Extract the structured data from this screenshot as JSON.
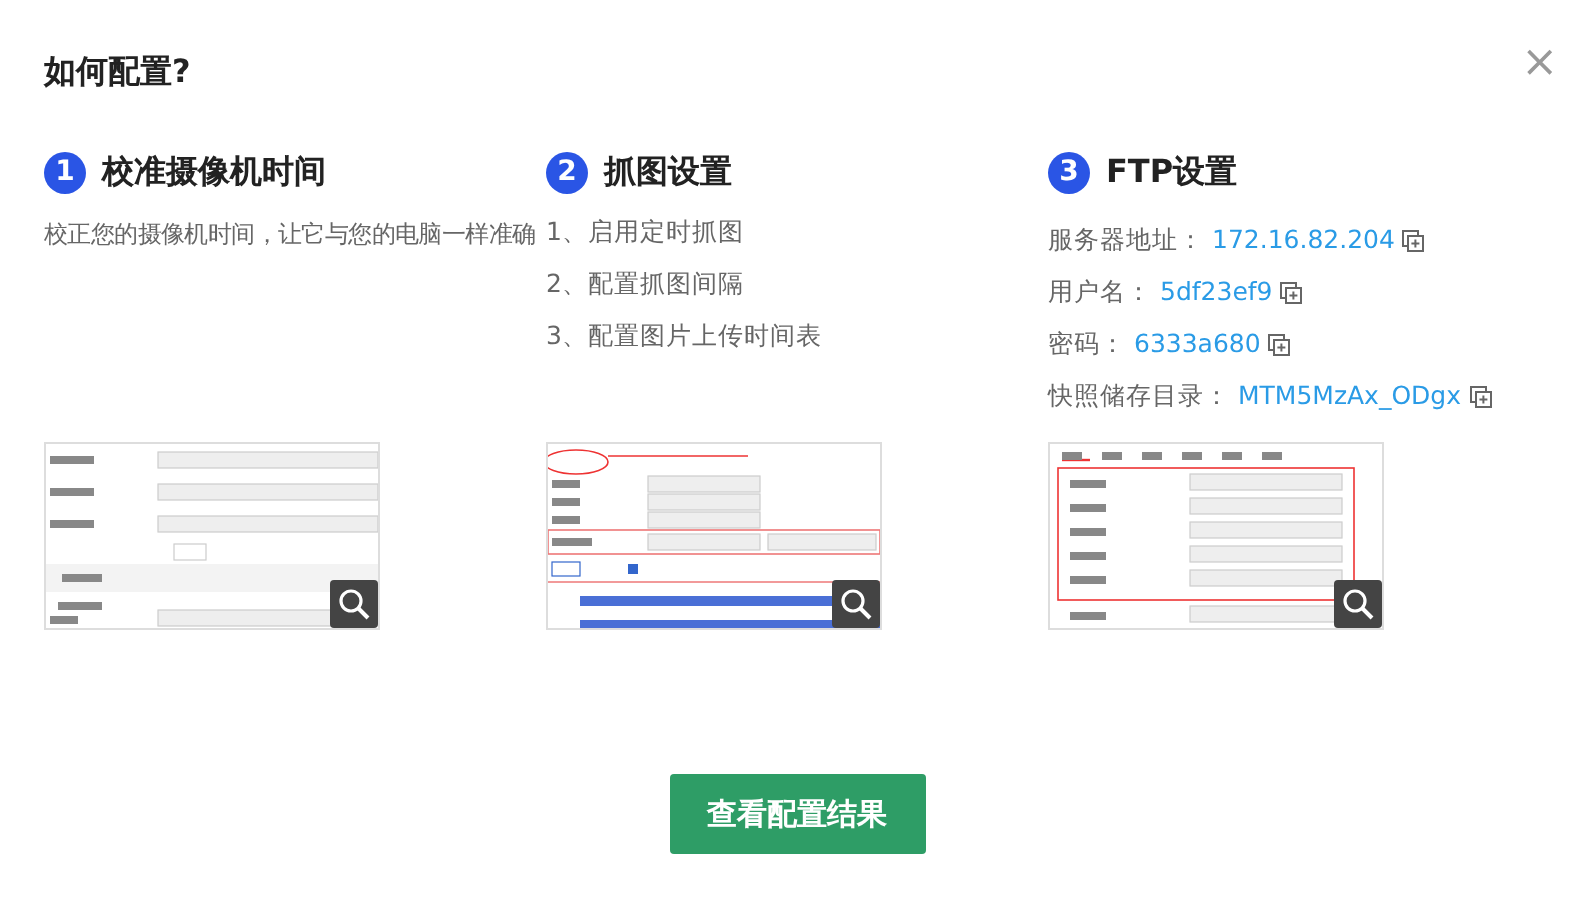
{
  "dialog": {
    "title": "如何配置?",
    "close": "×"
  },
  "steps": [
    {
      "number": "1",
      "title": "校准摄像机时间",
      "kind": "text",
      "description": "校正您的摄像机时间，让它与您的电脑一样准确",
      "preview": {
        "kind": "time"
      }
    },
    {
      "number": "2",
      "title": "抓图设置",
      "kind": "list",
      "items": [
        "1、启用定时抓图",
        "2、配置抓图间隔",
        "3、配置图片上传时间表"
      ],
      "preview": {
        "kind": "capture"
      }
    },
    {
      "number": "3",
      "title": "FTP设置",
      "kind": "fields",
      "fields": [
        {
          "label": "服务器地址：",
          "value": "172.16.82.204"
        },
        {
          "label": "用户名：",
          "value": "5df23ef9"
        },
        {
          "label": "密码：",
          "value": "6333a680"
        },
        {
          "label": "快照储存目录：",
          "value": "MTM5MzAx_ODgx"
        }
      ],
      "preview": {
        "kind": "ftp"
      }
    }
  ],
  "button": "查看配置结果"
}
